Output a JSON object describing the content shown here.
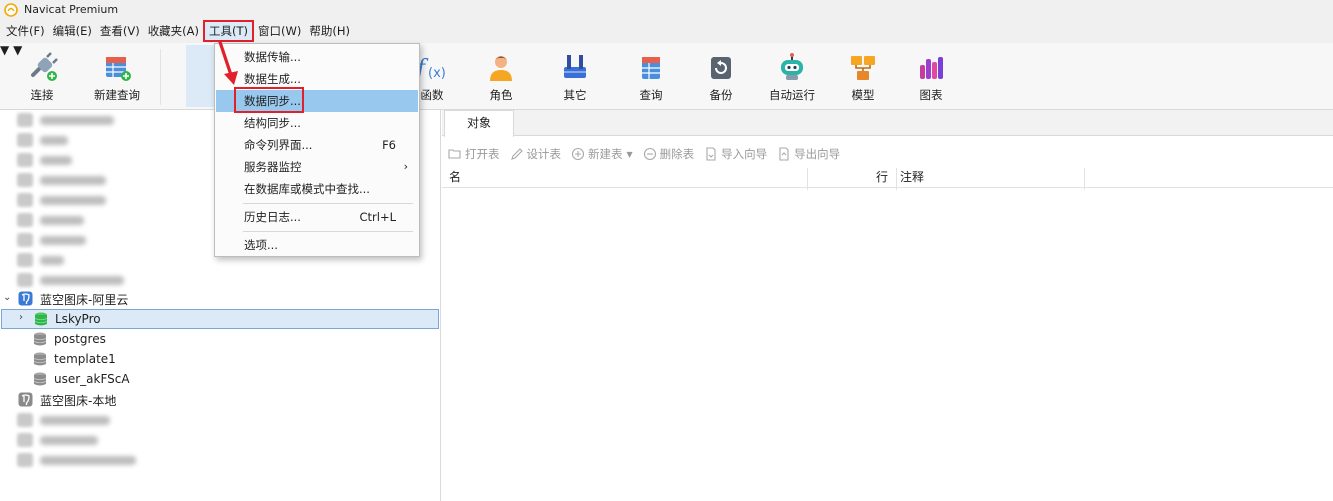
{
  "window": {
    "title": "Navicat Premium"
  },
  "menubar": {
    "items": [
      {
        "label": "文件(F)"
      },
      {
        "label": "编辑(E)"
      },
      {
        "label": "查看(V)"
      },
      {
        "label": "收藏夹(A)"
      },
      {
        "label": "工具(T)",
        "active": true
      },
      {
        "label": "窗口(W)"
      },
      {
        "label": "帮助(H)"
      }
    ]
  },
  "toolbar": {
    "connect": "连接",
    "new_query": "新建查询",
    "function": "函数",
    "role": "角色",
    "others": "其它",
    "query": "查询",
    "backup": "备份",
    "automation": "自动运行",
    "model": "模型",
    "chart": "图表"
  },
  "tools_menu": {
    "items": [
      {
        "label": "数据传输..."
      },
      {
        "label": "数据生成..."
      },
      {
        "label": "数据同步...",
        "highlighted": true
      },
      {
        "label": "结构同步..."
      },
      {
        "label": "命令列界面...",
        "shortcut": "F6"
      },
      {
        "label": "服务器监控",
        "submenu": true
      },
      {
        "label": "在数据库或模式中查找..."
      },
      {
        "label": "历史日志...",
        "shortcut": "Ctrl+L"
      },
      {
        "label": "选项..."
      }
    ]
  },
  "navigator": {
    "connection_aliyun": "蓝空图床-阿里云",
    "databases": [
      {
        "label": "LskyPro",
        "selected": true
      },
      {
        "label": "postgres"
      },
      {
        "label": "template1"
      },
      {
        "label": "user_akFScA"
      }
    ],
    "connection_local": "蓝空图床-本地"
  },
  "objects": {
    "tab": "对象",
    "actions": {
      "open_table": "打开表",
      "design_table": "设计表",
      "new_table": "新建表",
      "delete_table": "删除表",
      "import_wizard": "导入向导",
      "export_wizard": "导出向导"
    },
    "columns": {
      "name": "名",
      "rows": "行",
      "comment": "注释"
    }
  },
  "colors": {
    "accent_red": "#e0202a",
    "selection_blue": "#dceaf7",
    "menu_highlight": "#99c8ee",
    "db_active_green": "#2fb54a"
  }
}
